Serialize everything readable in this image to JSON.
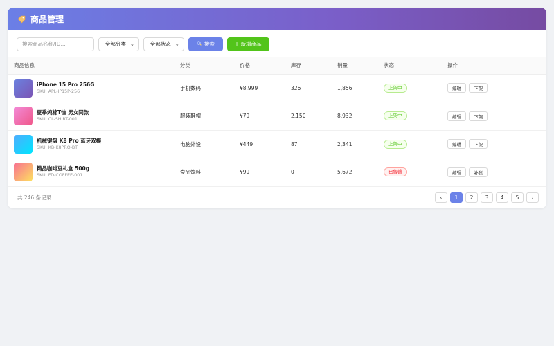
{
  "header": {
    "title": "商品管理",
    "icon": "tag-icon"
  },
  "toolbar": {
    "search_placeholder": "搜索商品名称/ID...",
    "category_select": "全部分类",
    "status_select": "全部状态",
    "search_label": "搜索",
    "add_label": "+ 新增商品"
  },
  "table": {
    "columns": [
      "商品信息",
      "分类",
      "价格",
      "库存",
      "销量",
      "状态",
      "操作"
    ],
    "rows": [
      {
        "name": "iPhone 15 Pro 256G",
        "sku": "SKU: APL-IP15P-256",
        "category": "手机数码",
        "price": "¥8,999",
        "stock": "326",
        "sales": "1,856",
        "status": "上架中",
        "actions": [
          "编辑",
          "下架"
        ]
      },
      {
        "name": "夏季纯棉T恤 男女同款",
        "sku": "SKU: CL-SHIRT-001",
        "category": "服装鞋帽",
        "price": "¥79",
        "stock": "2,150",
        "sales": "8,932",
        "status": "上架中",
        "actions": [
          "编辑",
          "下架"
        ]
      },
      {
        "name": "机械键盘 K8 Pro 蓝牙双模",
        "sku": "SKU: KB-K8PRO-BT",
        "category": "电脑外设",
        "price": "¥449",
        "stock": "87",
        "sales": "2,341",
        "status": "上架中",
        "actions": [
          "编辑",
          "下架"
        ]
      },
      {
        "name": "精品咖啡豆礼盒 500g",
        "sku": "SKU: FD-COFFEE-001",
        "category": "食品饮料",
        "price": "¥99",
        "stock": "0",
        "sales": "5,672",
        "status": "已售罄",
        "actions": [
          "编辑",
          "补货"
        ]
      }
    ]
  },
  "footer": {
    "total": "共 246 条记录",
    "pages": [
      "1",
      "2",
      "3",
      "4",
      "5"
    ],
    "current_page": "1",
    "prev": "‹",
    "next": "›"
  },
  "colors": {
    "header_gradient_start": "#6b7fe6",
    "header_gradient_end": "#764ba2",
    "primary": "#6b82e8",
    "success": "#52c41a",
    "danger": "#f5222d"
  },
  "thumbnails": [
    {
      "from": "#6a82e0",
      "to": "#7b55b5"
    },
    {
      "from": "#f28bd8",
      "to": "#f0578a"
    },
    {
      "from": "#4facfe",
      "to": "#00e5fe"
    },
    {
      "from": "#f86f91",
      "to": "#fde060"
    }
  ]
}
